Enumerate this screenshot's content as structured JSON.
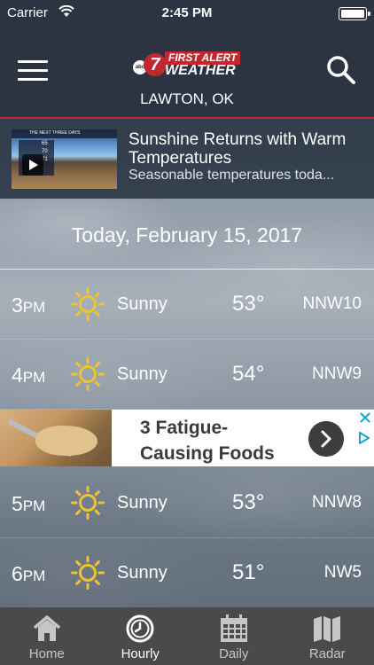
{
  "status_bar": {
    "carrier": "Carrier",
    "time": "2:45 PM"
  },
  "header": {
    "logo": {
      "network": "abc",
      "number": "7",
      "line1": "FIRST ALERT",
      "line2": "WEATHER"
    },
    "location": "LAWTON, OK"
  },
  "article": {
    "title": "Sunshine Returns with Warm Temperatures",
    "subtitle": "Seasonable temperatures toda...",
    "thumb": {
      "header": "THE NEXT THREE DAYS",
      "rows": [
        "65",
        "70",
        "71"
      ]
    }
  },
  "forecast": {
    "date": "Today, February 15, 2017",
    "rows_top": [
      {
        "hour": "3",
        "ampm": "PM",
        "condition": "Sunny",
        "temp": "53°",
        "wind": "NNW10",
        "icon": "sun-icon"
      },
      {
        "hour": "4",
        "ampm": "PM",
        "condition": "Sunny",
        "temp": "54°",
        "wind": "NNW9",
        "icon": "sun-icon"
      }
    ],
    "rows_bottom": [
      {
        "hour": "5",
        "ampm": "PM",
        "condition": "Sunny",
        "temp": "53°",
        "wind": "NNW8",
        "icon": "sun-icon"
      },
      {
        "hour": "6",
        "ampm": "PM",
        "condition": "Sunny",
        "temp": "51°",
        "wind": "NW5",
        "icon": "sun-icon"
      }
    ]
  },
  "ad": {
    "line1": "3 Fatigue-",
    "line2": "Causing Foods"
  },
  "tabs": [
    {
      "label": "Home",
      "icon": "home-icon"
    },
    {
      "label": "Hourly",
      "icon": "clock-icon",
      "active": true
    },
    {
      "label": "Daily",
      "icon": "calendar-icon"
    },
    {
      "label": "Radar",
      "icon": "map-icon"
    }
  ],
  "colors": {
    "header_bg": "#2b3440",
    "accent_red": "#c2272d",
    "sun": "#f2c230",
    "tabbar_bg": "#4a4a4a"
  }
}
